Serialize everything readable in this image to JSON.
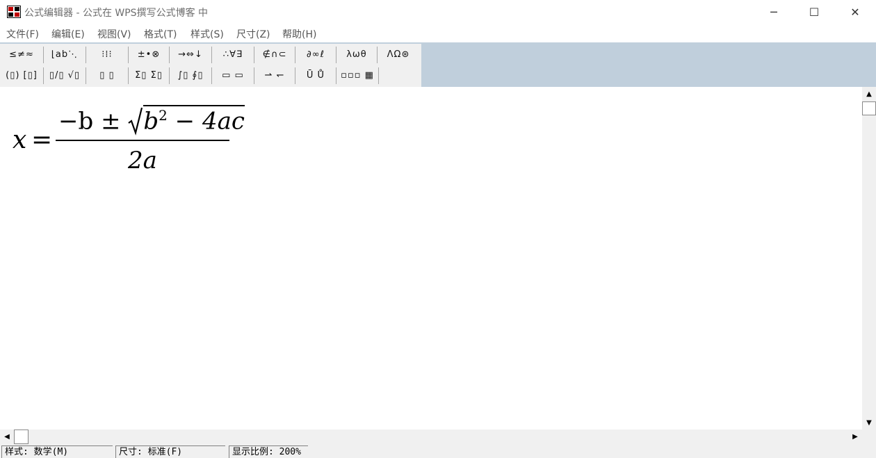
{
  "window": {
    "title": "公式编辑器 - 公式在 WPS撰写公式博客 中",
    "minimize_glyph": "─",
    "maximize_glyph": "☐",
    "close_glyph": "✕"
  },
  "menu": [
    "文件(F)",
    "编辑(E)",
    "视图(V)",
    "格式(T)",
    "样式(S)",
    "尺寸(Z)",
    "帮助(H)"
  ],
  "palette": {
    "row1": [
      "≤≠≈",
      "⌊ab⋱",
      "⁝⁞⁝",
      "±•⊗",
      "→⇔↓",
      "∴∀∃",
      "∉∩⊂",
      "∂∞ℓ",
      "λωθ",
      "ΛΩ⊛"
    ],
    "row2": [
      "(▯) [▯]",
      "▯/▯ √▯",
      "▯ ▯",
      "Σ▯ Σ▯",
      "∫▯ ∮▯",
      "▭ ▭",
      "⇀ ↽",
      "Ū Ů",
      "▫▫▫ ▦"
    ]
  },
  "equation": {
    "lhs": "x",
    "equals": "=",
    "numerator_prefix": "−b ± ",
    "radicand": "b",
    "exponent": "2",
    "radicand_rest": " − 4ac",
    "denominator": "2a"
  },
  "scrollbars": {
    "up_glyph": "▲",
    "down_glyph": "▼",
    "left_glyph": "◀",
    "right_glyph": "▶"
  },
  "status": {
    "style": "样式: 数学(M)",
    "size": "尺寸: 标准(F)",
    "zoom": "显示比例: 200%"
  }
}
